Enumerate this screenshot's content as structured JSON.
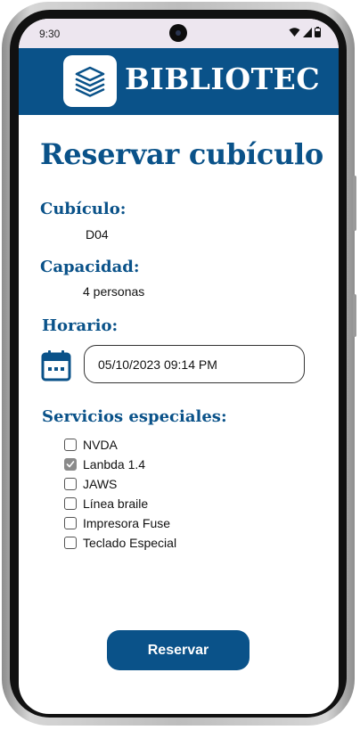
{
  "status_bar": {
    "time": "9:30",
    "icons": [
      "wifi-icon",
      "signal-icon",
      "battery-icon"
    ]
  },
  "header": {
    "logo_icon": "books-stack-icon",
    "app_name": "BIBLIOTEC"
  },
  "page": {
    "title": "Reservar cubículo"
  },
  "cubicle": {
    "label": "Cubículo:",
    "value": "D04"
  },
  "capacity": {
    "label": "Capacidad:",
    "value": "4 personas"
  },
  "schedule": {
    "label": "Horario:",
    "calendar_icon": "calendar-icon",
    "value": "05/10/2023 09:14 PM"
  },
  "services": {
    "label": "Servicios especiales:",
    "items": [
      {
        "label": "NVDA",
        "checked": false
      },
      {
        "label": "Lanbda 1.4",
        "checked": true
      },
      {
        "label": "JAWS",
        "checked": false
      },
      {
        "label": "Línea braile",
        "checked": false
      },
      {
        "label": "Impresora Fuse",
        "checked": false
      },
      {
        "label": "Teclado Especial",
        "checked": false
      }
    ]
  },
  "actions": {
    "reserve_label": "Reservar"
  },
  "colors": {
    "primary": "#0a5289",
    "status_bar": "#ede6ef",
    "checkbox_checked": "#8a8a8a"
  }
}
